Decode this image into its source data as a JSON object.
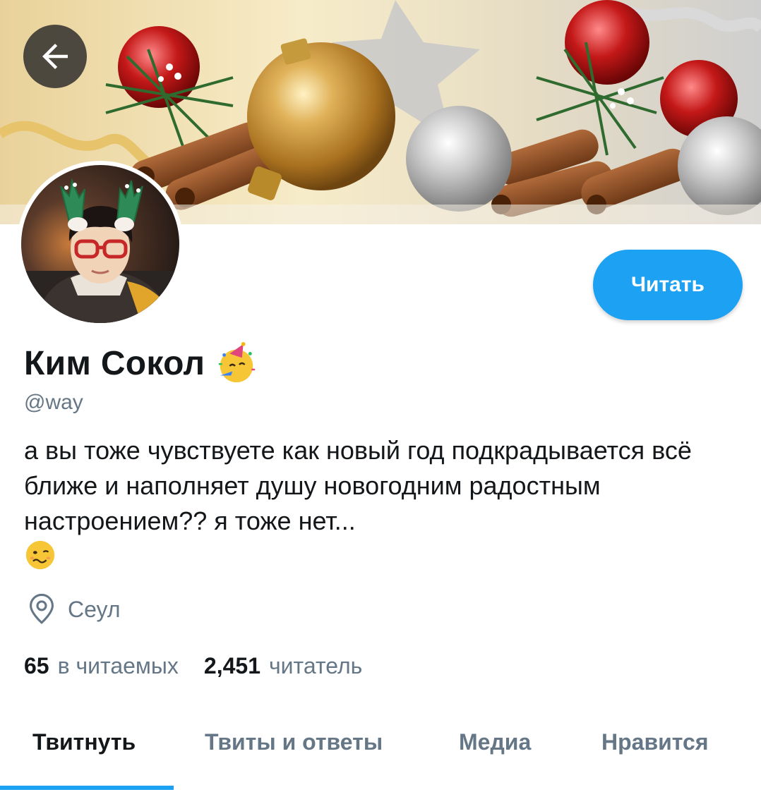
{
  "header": {
    "back_icon": "arrow-left-icon"
  },
  "profile": {
    "name": "Ким Сокол",
    "name_emoji": "partying-face-emoji",
    "handle": "@way",
    "follow_label": "Читать",
    "bio": "а вы тоже чувствуете как новый год подкрадывается всё ближе и наполняет душу новогодним радостным настроением?? я тоже нет...",
    "bio_emoji": "woozy-face-emoji",
    "location_icon": "location-pin-icon",
    "location": "Сеул"
  },
  "stats": {
    "following_count": "65",
    "following_label": "в читаемых",
    "followers_count": "2,451",
    "followers_label": "читатель"
  },
  "tabs": [
    {
      "label": "Твитнуть",
      "active": true
    },
    {
      "label": "Твиты и ответы",
      "active": false
    },
    {
      "label": "Медиа",
      "active": false
    },
    {
      "label": "Нравится",
      "active": false
    }
  ],
  "colors": {
    "accent": "#1da1f2",
    "text_primary": "#14171a",
    "text_secondary": "#657786"
  }
}
